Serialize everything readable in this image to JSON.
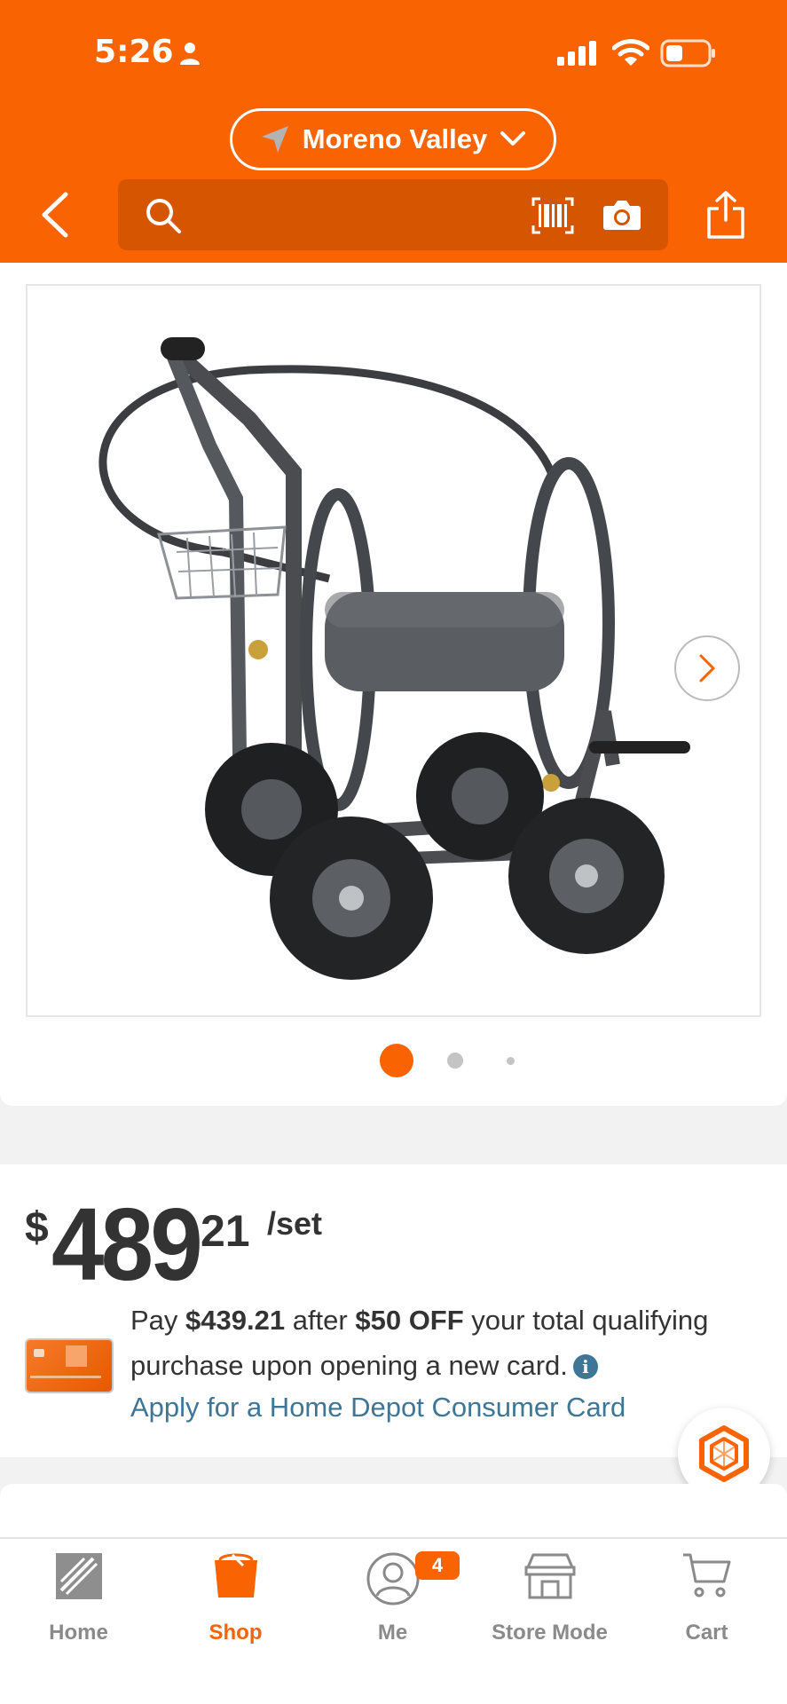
{
  "status_bar": {
    "time": "5:26"
  },
  "header": {
    "location": "Moreno Valley",
    "search": {
      "placeholder": ""
    }
  },
  "gallery": {
    "image_alt": "Garden hose reel cart with basket and four pneumatic wheels",
    "page_count": 3,
    "current_page": 1
  },
  "price": {
    "currency": "$",
    "dollars": "489",
    "cents": "21",
    "unit": "/set"
  },
  "promo": {
    "text_1": "Pay ",
    "amount": "$439.21",
    "text_2": " after ",
    "discount": "$50 OFF",
    "text_3": " your total qualifying purchase upon opening a new card.",
    "apply_link": "Apply for a Home Depot Consumer Card"
  },
  "tabs": [
    {
      "label": "Home"
    },
    {
      "label": "Shop"
    },
    {
      "label": "Me",
      "badge": "4"
    },
    {
      "label": "Store Mode"
    },
    {
      "label": "Cart"
    }
  ],
  "colors": {
    "brand": "#f96302",
    "link": "#3e7697"
  }
}
